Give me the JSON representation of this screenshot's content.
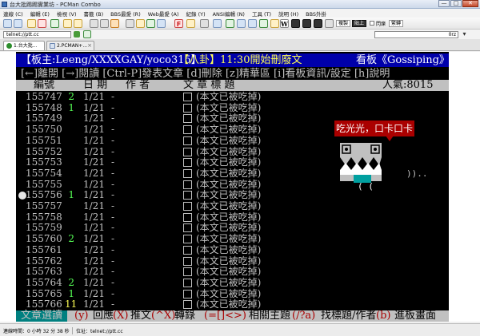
{
  "window": {
    "title": "台大批踢踢實業坊 - PCMan Combo",
    "buttons": [
      "—",
      "□",
      "✕"
    ]
  },
  "menu": [
    "連線 (C)",
    "編輯 (E)",
    "檢視 (V)",
    "書籤 (B)",
    "BBS最愛 (R)",
    "Web最愛 (A)",
    "紀錄 (Y)",
    "ANSI編輯 (N)",
    "工具 (T)",
    "說明 (H)",
    "BBS外掛"
  ],
  "toolbar": {
    "letter_w": "W",
    "copy_btn": "複製",
    "paste_btn": "貼上",
    "blink_label": "閃爍",
    "encoding_btn": "繁轉"
  },
  "address": {
    "value": "telnet://ptt.cc",
    "search_placeholder": "0rz"
  },
  "tabs": [
    {
      "label": "1.台大批..."
    },
    {
      "label": "2.PCMAN+..."
    }
  ],
  "terminal": {
    "header_left": "【板主:Leeng/XXXXGAY/yoco315】",
    "header_mid": "【八卦】11:30開始刪廢文",
    "header_right": "看板《Gossiping》",
    "command_line": "[←]離開 [→]閱讀 [Ctrl-P]發表文章 [d]刪除 [z]精華區 [i]看板資訊/設定 [h]說明",
    "columns": {
      "num": "編號",
      "date": "日 期",
      "author": "作  者",
      "title": "文  章  標  題",
      "popularity": "人氣:8015"
    },
    "rows": [
      {
        "num": "155747",
        "push": "2",
        "date": "1/21",
        "author": "-",
        "title": "(本文已被吃掉)"
      },
      {
        "num": "155748",
        "push": "1",
        "date": "1/21",
        "author": "-",
        "title": "(本文已被吃掉)"
      },
      {
        "num": "155749",
        "push": "",
        "date": "1/21",
        "author": "-",
        "title": "(本文已被吃掉)"
      },
      {
        "num": "155750",
        "push": "",
        "date": "1/21",
        "author": "-",
        "title": "(本文已被吃掉)"
      },
      {
        "num": "155751",
        "push": "",
        "date": "1/21",
        "author": "-",
        "title": "(本文已被吃掉)"
      },
      {
        "num": "155752",
        "push": "",
        "date": "1/21",
        "author": "-",
        "title": "(本文已被吃掉)"
      },
      {
        "num": "155753",
        "push": "",
        "date": "1/21",
        "author": "-",
        "title": "(本文已被吃掉)"
      },
      {
        "num": "155754",
        "push": "",
        "date": "1/21",
        "author": "-",
        "title": "(本文已被吃掉)"
      },
      {
        "num": "155755",
        "push": "",
        "date": "1/21",
        "author": "-",
        "title": "(本文已被吃掉)"
      },
      {
        "num": "155756",
        "push": "1",
        "date": "1/21",
        "author": "-",
        "title": "(本文已被吃掉)"
      },
      {
        "num": "155757",
        "push": "",
        "date": "1/21",
        "author": "-",
        "title": "(本文已被吃掉)"
      },
      {
        "num": "155758",
        "push": "",
        "date": "1/21",
        "author": "-",
        "title": "(本文已被吃掉)"
      },
      {
        "num": "155759",
        "push": "",
        "date": "1/21",
        "author": "-",
        "title": "(本文已被吃掉)"
      },
      {
        "num": "155760",
        "push": "2",
        "date": "1/21",
        "author": "-",
        "title": "(本文已被吃掉)"
      },
      {
        "num": "155761",
        "push": "",
        "date": "1/21",
        "author": "-",
        "title": "(本文已被吃掉)"
      },
      {
        "num": "155762",
        "push": "",
        "date": "1/21",
        "author": "-",
        "title": "(本文已被吃掉)"
      },
      {
        "num": "155763",
        "push": "",
        "date": "1/21",
        "author": "-",
        "title": "(本文已被吃掉)"
      },
      {
        "num": "155764",
        "push": "2",
        "date": "1/21",
        "author": "-",
        "title": "(本文已被吃掉)"
      },
      {
        "num": "155765",
        "push": "1",
        "date": "1/21",
        "author": "-",
        "title": "(本文已被吃掉)"
      },
      {
        "num": "155766",
        "push": "11",
        "date": "1/21",
        "author": "-",
        "title": "(本文已被吃掉)"
      }
    ],
    "footer": {
      "main": "文章選讀",
      "k1": "(y)",
      "t1": "回應",
      "k2": "(X)",
      "t2": "推文",
      "k3": "(^X)",
      "t3": "轉錄",
      "k4": "(=[]<>)",
      "t4": "相關主題",
      "k5": "(/?a)",
      "t5": "找標題/作者",
      "k6": "(b)",
      "t6": "進板畫面"
    },
    "mascot": {
      "bubble": "吃光光，口卡口卡",
      "trail": "))..",
      "face_marks": "( ("
    }
  },
  "statusbar": {
    "left": "連線時間：0 小時 32 分 38 秒",
    "right": "位址：telnet://ptt.cc"
  },
  "colors": {
    "terminal_bg": "#000000",
    "header_bg": "#0000aa",
    "bar_gray": "#c0c0c0",
    "push_green": "#55ff55",
    "push_yellow": "#ffff55",
    "bubble_red": "#aa0000",
    "footer_teal": "#008080"
  }
}
